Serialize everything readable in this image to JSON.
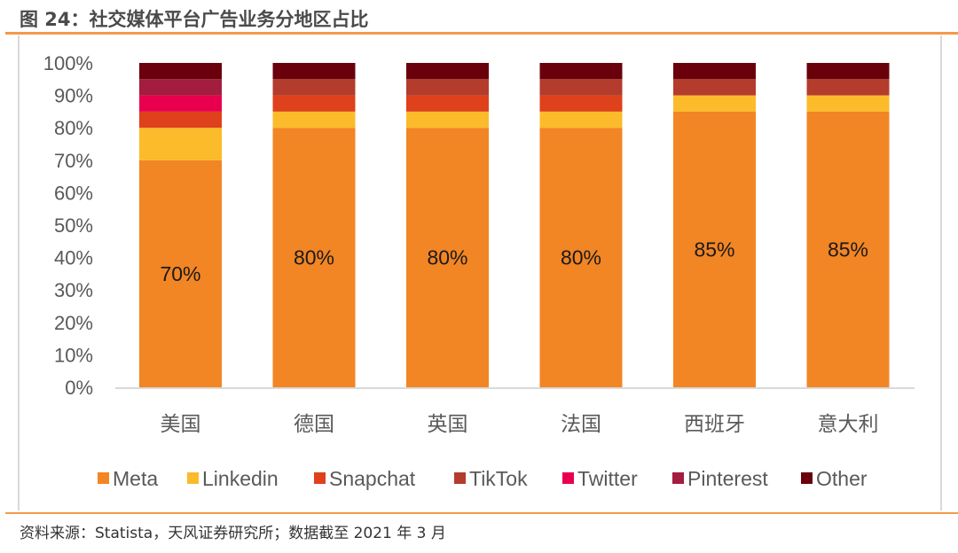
{
  "header": {
    "title": "图 24：社交媒体平台广告业务分地区占比"
  },
  "footer": {
    "source": "资料来源：Statista，天风证券研究所；数据截至 2021 年 3 月"
  },
  "colors": {
    "accent_rule": "#f39a4a",
    "Meta": "#f28524",
    "Linkedin": "#fbbb2a",
    "Snapchat": "#de411b",
    "TikTok": "#b33c2c",
    "Twitter": "#e8004f",
    "Pinterest": "#a31d3f",
    "Other": "#69000b"
  },
  "chart_data": {
    "type": "bar",
    "stacked": true,
    "title": "社交媒体平台广告业务分地区占比",
    "xlabel": "",
    "ylabel": "",
    "ylim": [
      0,
      100
    ],
    "yticks": [
      "0%",
      "10%",
      "20%",
      "30%",
      "40%",
      "50%",
      "60%",
      "70%",
      "80%",
      "90%",
      "100%"
    ],
    "grid": false,
    "legend": "bottom",
    "categories": [
      "美国",
      "德国",
      "英国",
      "法国",
      "西班牙",
      "意大利"
    ],
    "series": [
      {
        "name": "Meta",
        "values": [
          70,
          80,
          80,
          80,
          85,
          85
        ]
      },
      {
        "name": "Linkedin",
        "values": [
          10,
          5,
          5,
          5,
          5,
          5
        ]
      },
      {
        "name": "Snapchat",
        "values": [
          5,
          5,
          5,
          5,
          0,
          0
        ]
      },
      {
        "name": "TikTok",
        "values": [
          0,
          5,
          5,
          5,
          5,
          5
        ]
      },
      {
        "name": "Twitter",
        "values": [
          5,
          0,
          0,
          0,
          0,
          0
        ]
      },
      {
        "name": "Pinterest",
        "values": [
          5,
          0,
          0,
          0,
          0,
          0
        ]
      },
      {
        "name": "Other",
        "values": [
          5,
          5,
          5,
          5,
          5,
          5
        ]
      }
    ],
    "data_labels": [
      "70%",
      "80%",
      "80%",
      "80%",
      "85%",
      "85%"
    ],
    "data_label_series": "Meta"
  }
}
